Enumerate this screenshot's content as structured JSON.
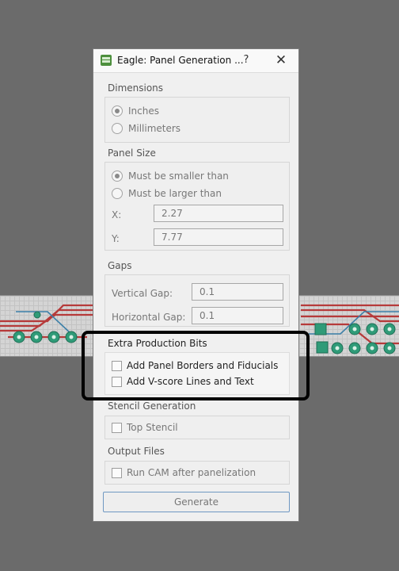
{
  "window": {
    "title": "Eagle: Panel Generation ...",
    "help_label": "?",
    "close_label": "✕"
  },
  "dimensions": {
    "label": "Dimensions",
    "options": [
      "Inches",
      "Millimeters"
    ],
    "selected": "Inches"
  },
  "panel_size": {
    "label": "Panel Size",
    "options": [
      "Must be smaller than",
      "Must be larger than"
    ],
    "selected": "Must be smaller than",
    "x_label": "X:",
    "x_value": "2.27",
    "y_label": "Y:",
    "y_value": "7.77"
  },
  "gaps": {
    "label": "Gaps",
    "vertical_label": "Vertical Gap:",
    "vertical_value": "0.1",
    "horizontal_label": "Horizontal Gap:",
    "horizontal_value": "0.1"
  },
  "extra_production": {
    "label": "Extra Production Bits",
    "options": [
      "Add Panel Borders and Fiducials",
      "Add V-score Lines and Text"
    ]
  },
  "stencil": {
    "label": "Stencil Generation",
    "top_stencil": "Top Stencil"
  },
  "output": {
    "label": "Output Files",
    "run_cam": "Run CAM after panelization"
  },
  "generate_label": "Generate",
  "colors": {
    "trace_red": "#b63a3a",
    "trace_blue": "#3b7fa8",
    "pad_green": "#2f9b78",
    "highlight": "#000000"
  }
}
